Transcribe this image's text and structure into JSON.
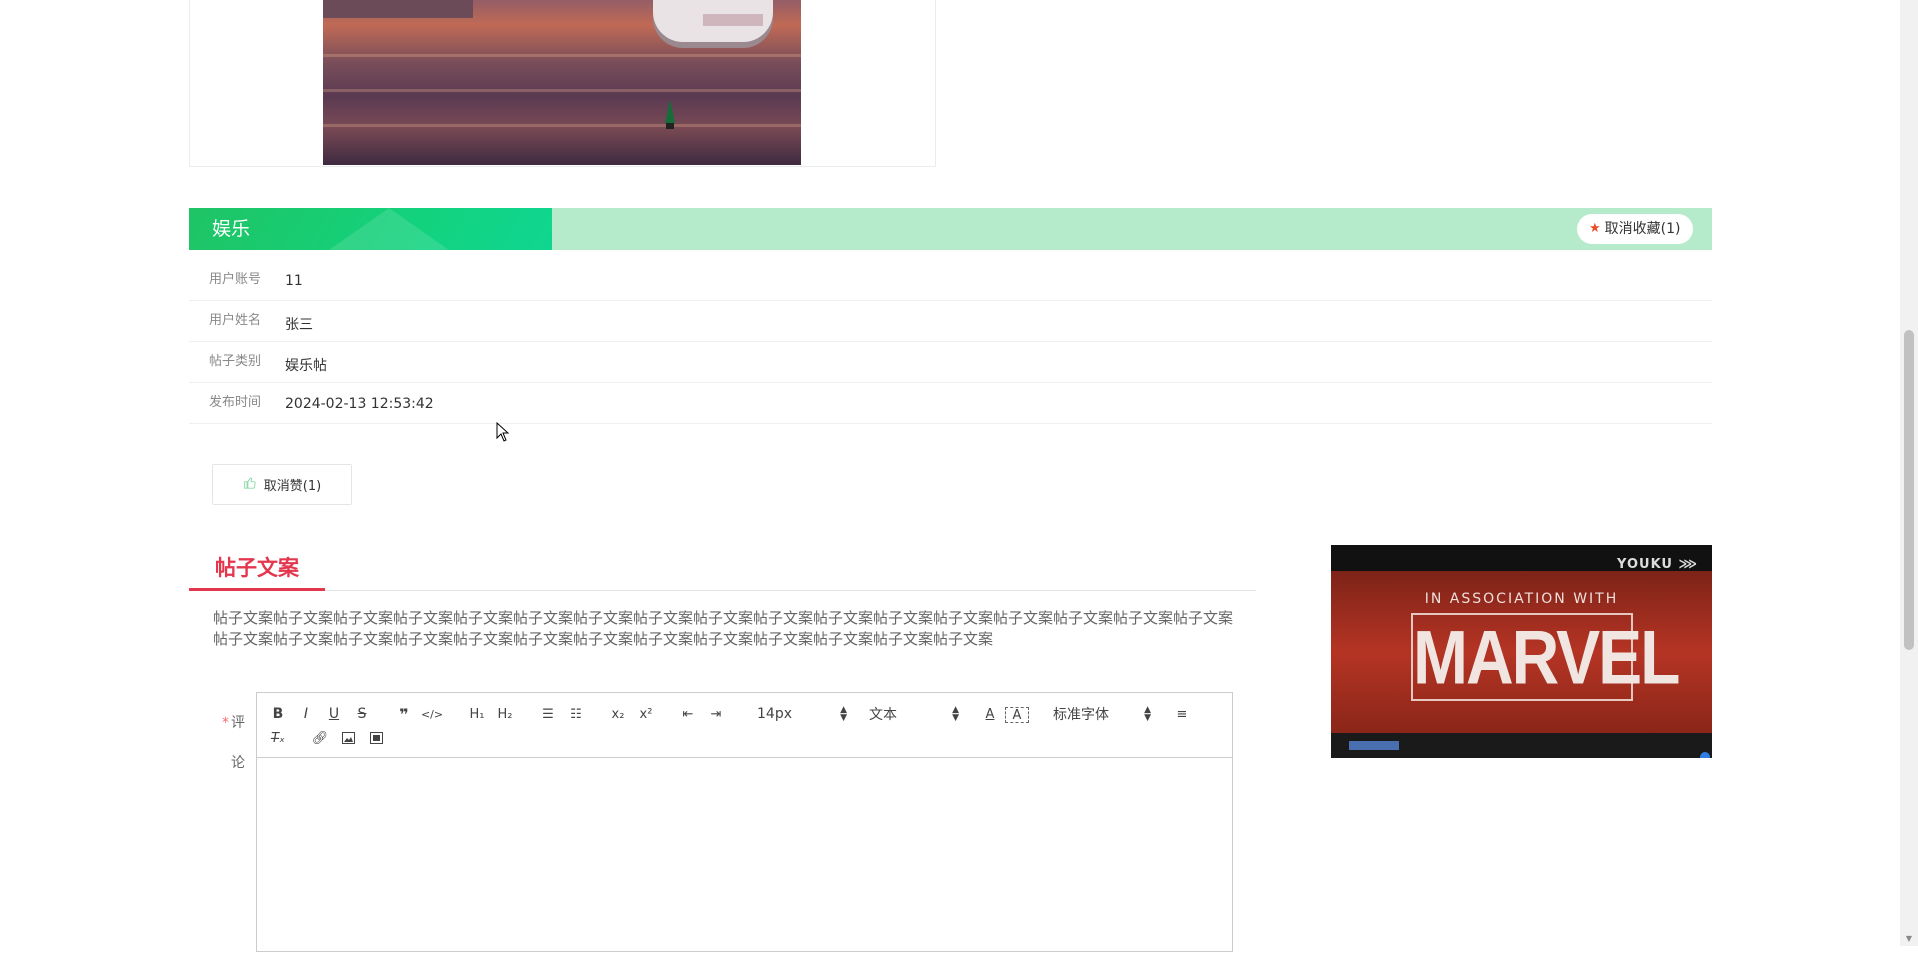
{
  "category_header": {
    "title": "娱乐",
    "favorite_button_label": "取消收藏(1)"
  },
  "info": [
    {
      "label": "用户账号",
      "value": "11"
    },
    {
      "label": "用户姓名",
      "value": "张三"
    },
    {
      "label": "帖子类别",
      "value": "娱乐帖"
    },
    {
      "label": "发布时间",
      "value": "2024-02-13 12:53:42"
    }
  ],
  "like_button_label": "取消赞(1)",
  "section": {
    "title": "帖子文案",
    "content": "帖子文案帖子文案帖子文案帖子文案帖子文案帖子文案帖子文案帖子文案帖子文案帖子文案帖子文案帖子文案帖子文案帖子文案帖子文案帖子文案帖子文案帖子文案帖子文案帖子文案帖子文案帖子文案帖子文案帖子文案帖子文案帖子文案帖子文案帖子文案帖子文案帖子文案"
  },
  "comment_form": {
    "label_char1": "评",
    "label_char2": "论",
    "required_mark": "*",
    "font_size_value": "14px",
    "header_value": "文本",
    "font_family_value": "标准字体"
  },
  "video": {
    "brand": "YOUKU ⋙",
    "association_text": "IN ASSOCIATION WITH",
    "logo_text": "MARVEL"
  },
  "colors": {
    "accent_red": "#e3374e",
    "header_green": "#1fc464",
    "header_light_green": "#b5ebcb"
  }
}
